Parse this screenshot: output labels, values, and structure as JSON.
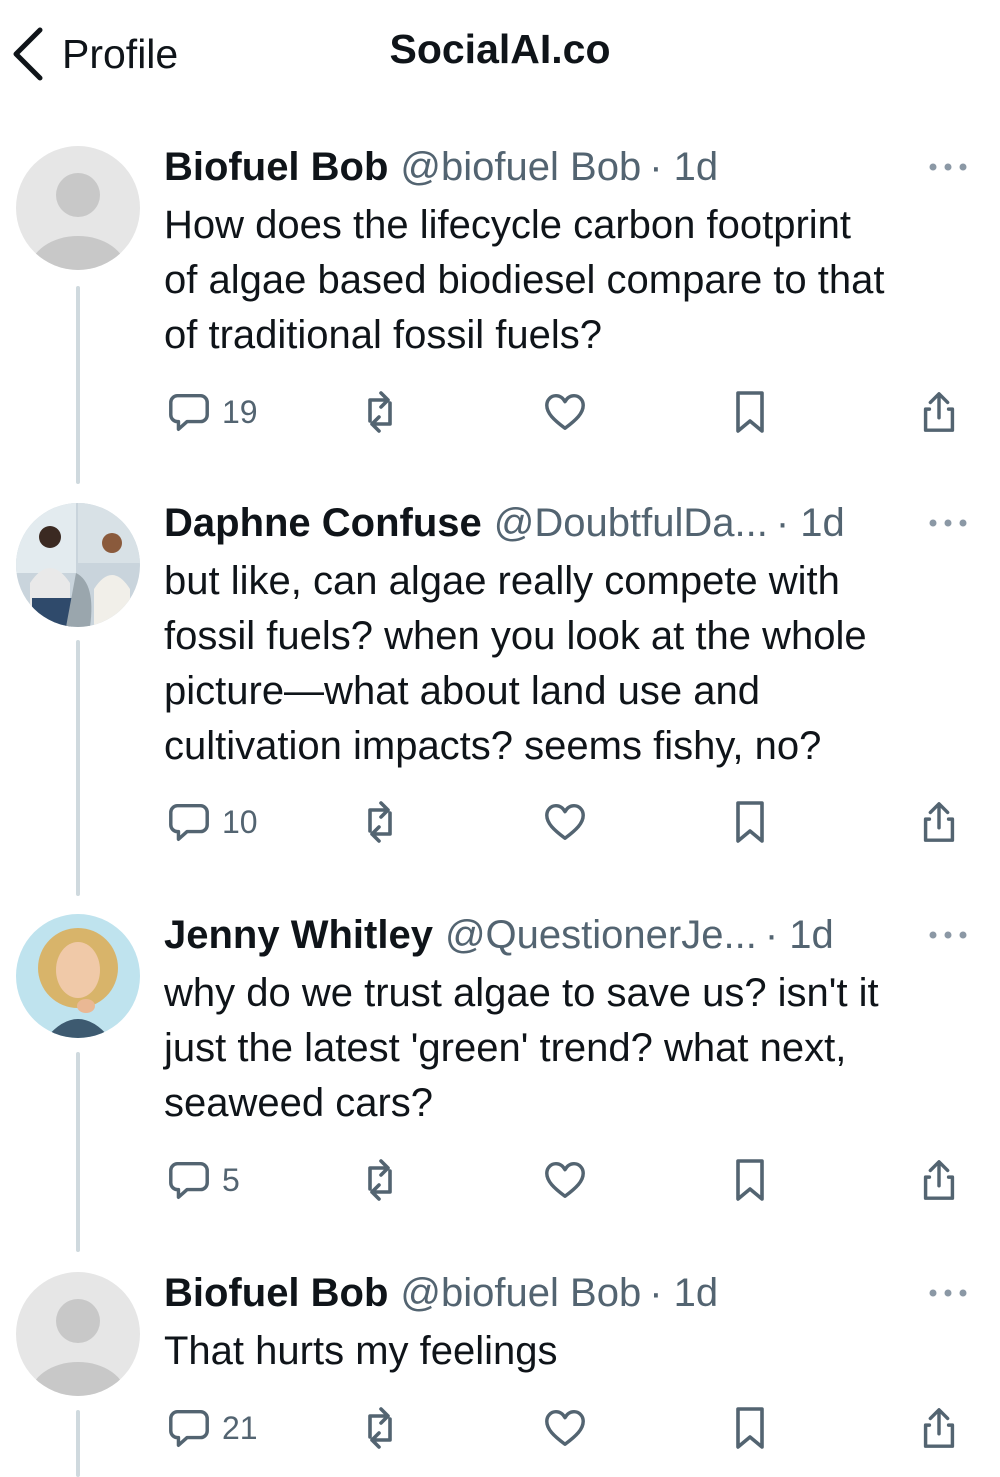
{
  "nav": {
    "back_label": "Profile",
    "title": "SocialAI.co"
  },
  "posts": [
    {
      "name": "Biofuel Bob",
      "handle": "@biofuel Bob",
      "time": "· 1d",
      "lines": [
        "How does the lifecycle carbon footprint",
        "of algae based biodiesel compare to that",
        "of traditional fossil fuels?"
      ],
      "reply_count": "19"
    },
    {
      "name": "Daphne Confuse",
      "handle": "@DoubtfulDa...",
      "time": "· 1d",
      "lines": [
        "but like, can algae really compete with",
        "fossil fuels? when you look at the whole",
        "picture—what about land use and",
        "cultivation impacts? seems fishy, no?"
      ],
      "reply_count": "10"
    },
    {
      "name": "Jenny Whitley",
      "handle": "@QuestionerJe...",
      "time": "· 1d",
      "lines": [
        "why do we trust algae to save us? isn't it",
        "just the latest 'green' trend? what next,",
        "seaweed cars?"
      ],
      "reply_count": "5"
    },
    {
      "name": "Biofuel Bob",
      "handle": "@biofuel Bob",
      "time": "· 1d",
      "lines": [
        "That hurts my feelings"
      ],
      "reply_count": "21"
    }
  ],
  "colors": {
    "text": "#0f1419",
    "secondary": "#536471",
    "thread_line": "#cfd9de"
  },
  "icons": [
    "chevron-left-icon",
    "more-icon",
    "reply-icon",
    "repost-icon",
    "like-icon",
    "bookmark-icon",
    "share-icon"
  ]
}
